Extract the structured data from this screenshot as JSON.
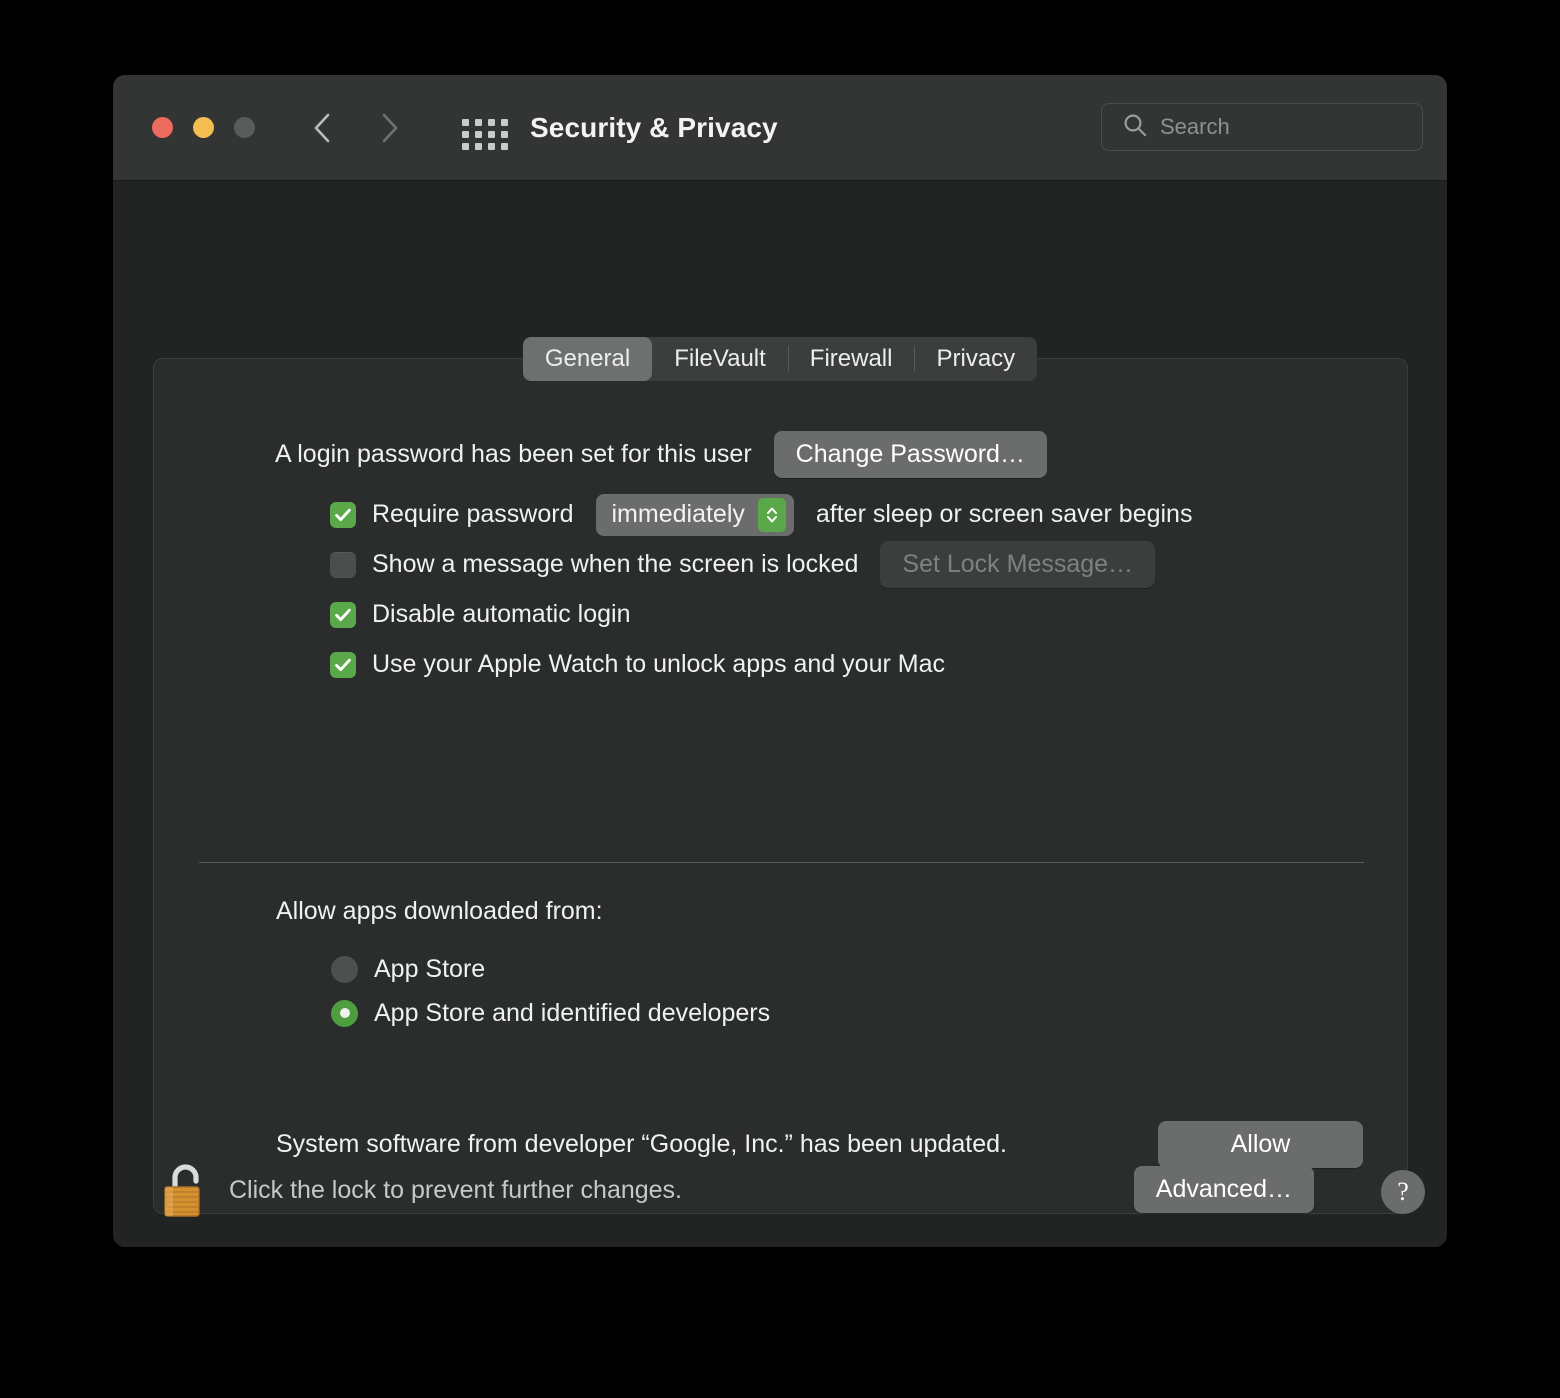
{
  "window": {
    "title": "Security & Privacy",
    "traffic_lights": {
      "close": "close-button",
      "minimize": "minimize-button",
      "zoom": "zoom-button"
    },
    "nav": {
      "back": "back-arrow",
      "forward": "forward-arrow"
    },
    "grid_button": "show-all-preferences",
    "search": {
      "placeholder": "Search",
      "value": ""
    }
  },
  "tabs": [
    {
      "label": "General",
      "active": true
    },
    {
      "label": "FileVault",
      "active": false
    },
    {
      "label": "Firewall",
      "active": false
    },
    {
      "label": "Privacy",
      "active": false
    }
  ],
  "general": {
    "password_status": "A login password has been set for this user",
    "change_password_label": "Change Password…",
    "options": [
      {
        "checked": true,
        "label_before": "Require password",
        "popup_value": "immediately",
        "label_after": "after sleep or screen saver begins"
      },
      {
        "checked": false,
        "label_before": "Show a message when the screen is locked",
        "button_label": "Set Lock Message…",
        "button_disabled": true
      },
      {
        "checked": true,
        "label_before": "Disable automatic login"
      },
      {
        "checked": true,
        "label_before": "Use your Apple Watch to unlock apps and your Mac"
      }
    ],
    "allow_apps_label": "Allow apps downloaded from:",
    "sources": [
      {
        "label": "App Store",
        "selected": false
      },
      {
        "label": "App Store and identified developers",
        "selected": true
      }
    ],
    "system_software_message": "System software from developer “Google, Inc.” has been updated.",
    "allow_button_label": "Allow"
  },
  "footer": {
    "lock_icon": "unlocked-padlock-icon",
    "lock_note": "Click the lock to prevent further changes.",
    "advanced_label": "Advanced…",
    "help_label": "?"
  },
  "colors": {
    "accent_green": "#5aa84a",
    "window_bg": "#212423",
    "titlebar_bg": "#323534",
    "panel_bg": "#2a2d2c",
    "button_bg": "#6a6d6c",
    "close": "#ED6A5E",
    "minimize": "#F4BD4F",
    "zoom": "#5A5C5B"
  }
}
